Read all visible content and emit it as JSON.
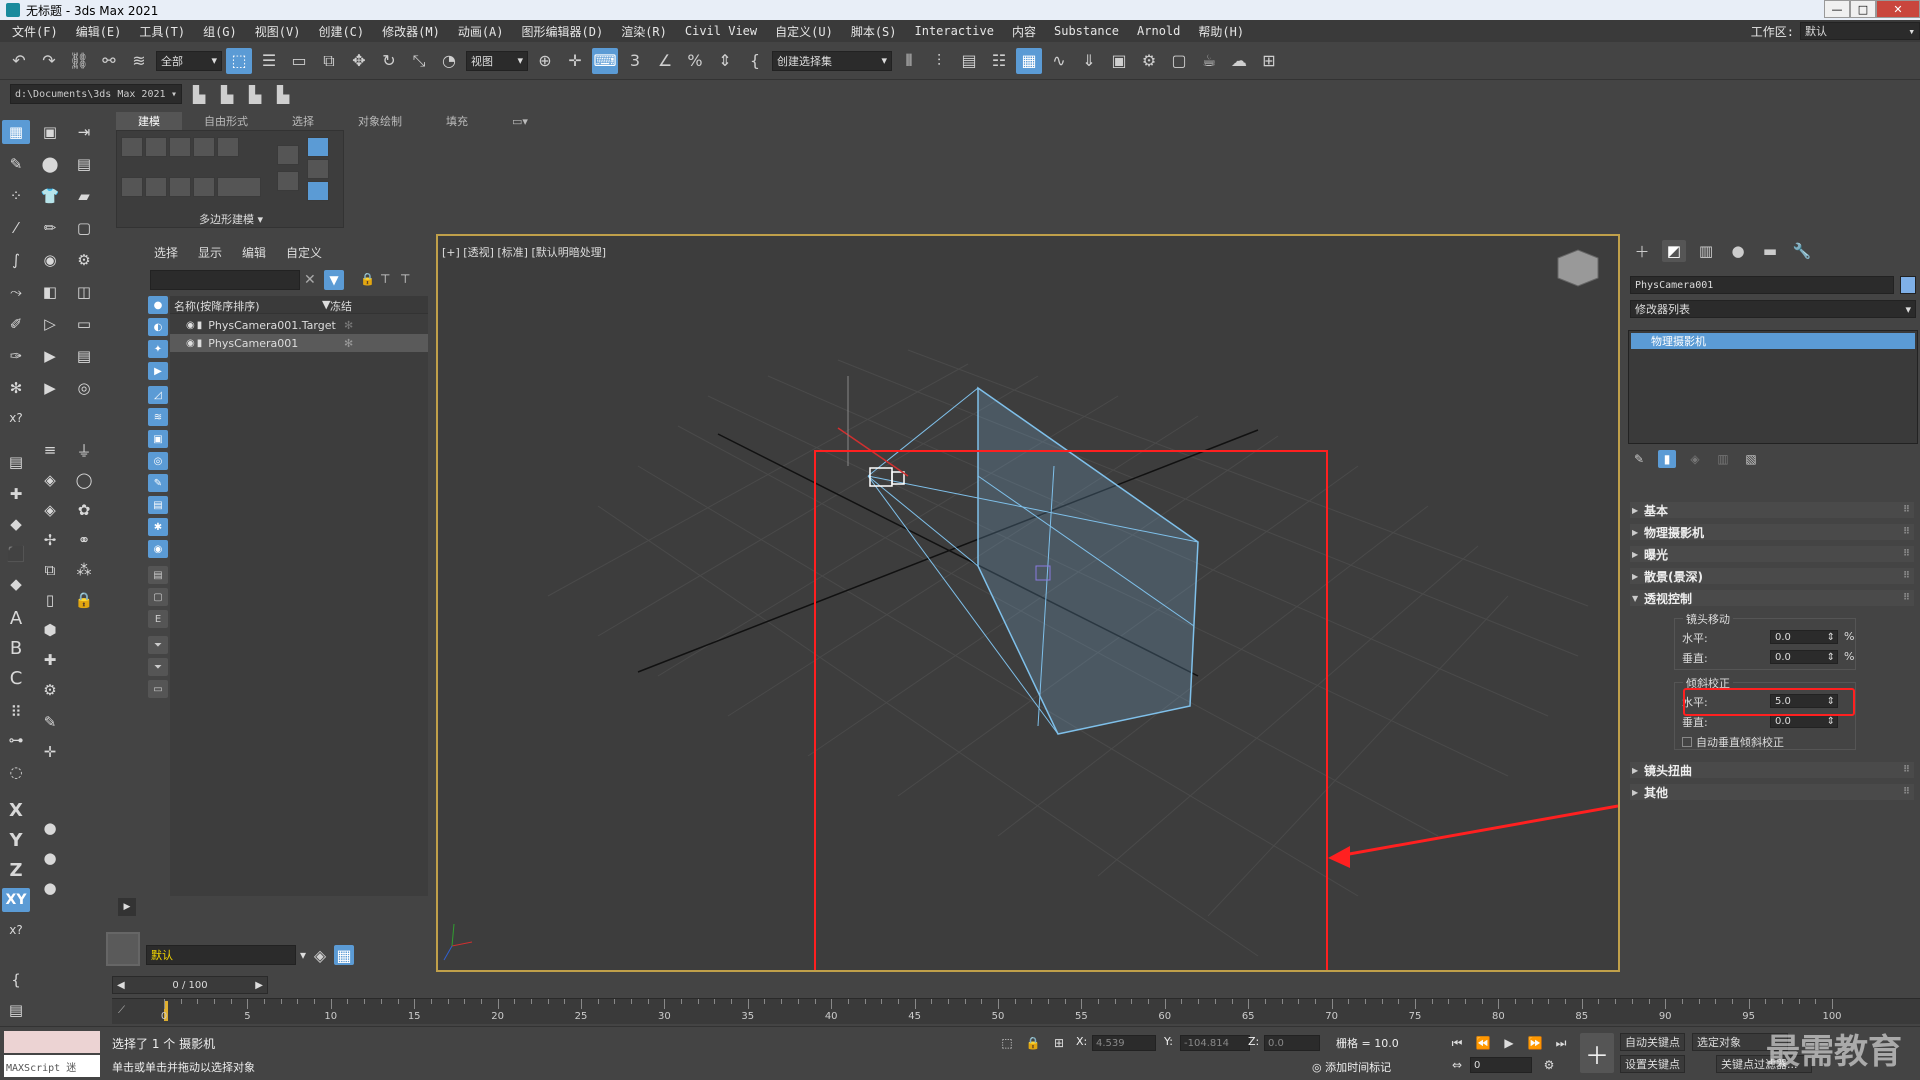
{
  "window": {
    "title": "无标题 - 3ds Max 2021",
    "min": "—",
    "max": "□",
    "close": "✕"
  },
  "menu": {
    "items": [
      "文件(F)",
      "编辑(E)",
      "工具(T)",
      "组(G)",
      "视图(V)",
      "创建(C)",
      "修改器(M)",
      "动画(A)",
      "图形编辑器(D)",
      "渲染(R)",
      "Civil View",
      "自定义(U)",
      "脚本(S)",
      "Interactive",
      "内容",
      "Substance",
      "Arnold",
      "帮助(H)"
    ],
    "workspace_label": "工作区:",
    "workspace_value": "默认"
  },
  "toolbar": {
    "filter_value": "全部",
    "refcoord_value": "视图",
    "selset_value": "创建选择集"
  },
  "pathbar": {
    "path": "d:\\Documents\\3ds Max 2021"
  },
  "ribbon": {
    "tabs": [
      "建模",
      "自由形式",
      "选择",
      "对象绘制",
      "填充"
    ],
    "panel_label": "多边形建模"
  },
  "explorer": {
    "tabs": [
      "选择",
      "显示",
      "编辑",
      "自定义"
    ],
    "col_name": "名称(按降序排序)",
    "col_frozen": "冻结",
    "rows": [
      {
        "name": "PhysCamera001.Target",
        "selected": false
      },
      {
        "name": "PhysCamera001",
        "selected": true
      }
    ],
    "layer": "默认"
  },
  "viewport": {
    "label": "[+] [透视] [标准] [默认明暗处理]"
  },
  "command_panel": {
    "object_name": "PhysCamera001",
    "object_color": "#7fb0e8",
    "modifier_list": "修改器列表",
    "stack_item": "物理摄影机",
    "rollouts": {
      "basic": "基本",
      "phys_camera": "物理摄影机",
      "exposure": "曝光",
      "bokeh": "散景(景深)",
      "perspective": "透视控制",
      "distortion": "镜头扭曲",
      "misc": "其他"
    },
    "lens_shift": {
      "title": "镜头移动",
      "h_label": "水平:",
      "h_value": "0.0",
      "v_label": "垂直:",
      "v_value": "0.0",
      "unit": "%"
    },
    "tilt": {
      "title": "倾斜校正",
      "h_label": "水平:",
      "h_value": "5.0",
      "v_label": "垂直:",
      "v_value": "0.0",
      "auto_label": "自动垂直倾斜校正"
    }
  },
  "timeline": {
    "frame": "0 / 100",
    "ticks": [
      "0",
      "5",
      "10",
      "15",
      "20",
      "25",
      "30",
      "35",
      "40",
      "45",
      "50",
      "55",
      "60",
      "65",
      "70",
      "75",
      "80",
      "85",
      "90",
      "95",
      "100"
    ]
  },
  "status": {
    "maxscript": "MAXScript 迷",
    "line1": "选择了 1 个 摄影机",
    "line2": "单击或单击并拖动以选择对象",
    "x_label": "X:",
    "x_value": "4.539",
    "y_label": "Y:",
    "y_value": "-104.814",
    "z_label": "Z:",
    "z_value": "0.0",
    "grid": "栅格 = 10.0",
    "add_time_tag": "添加时间标记",
    "auto_key": "自动关键点",
    "selected_obj": "选定对象",
    "set_key": "设置关键点",
    "key_filter": "关键点过滤器...",
    "frame_field": "0"
  },
  "watermark": "最需教育"
}
